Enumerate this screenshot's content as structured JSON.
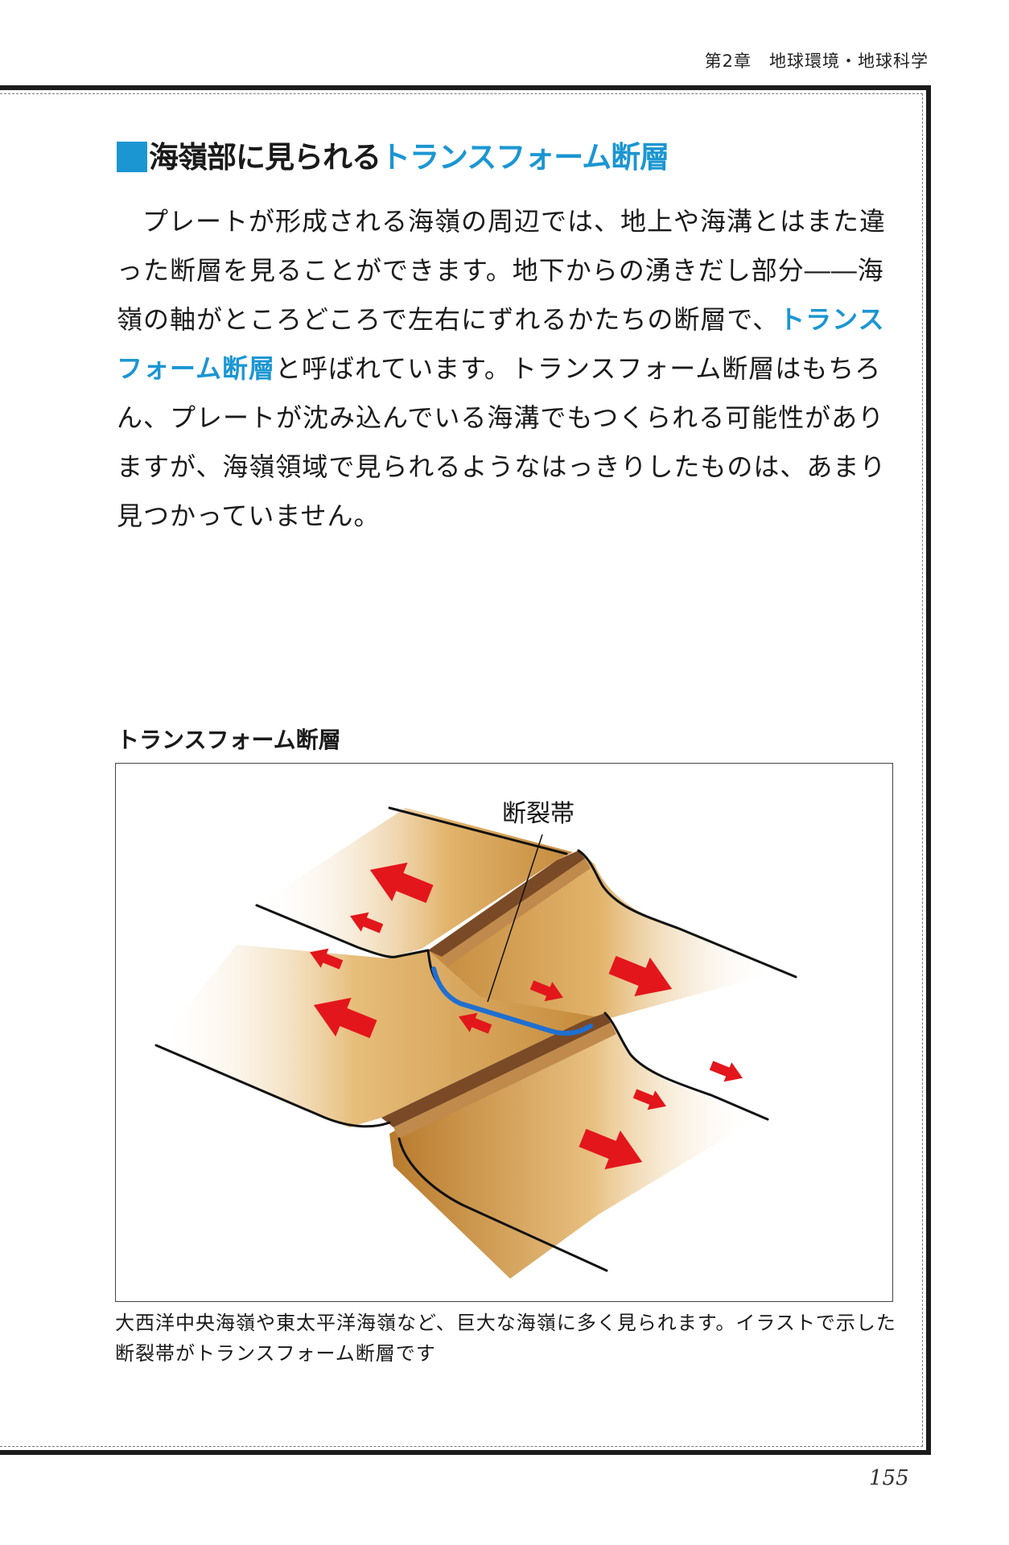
{
  "running_head": "第2章　地球環境・地球科学",
  "section": {
    "title_plain": "海嶺部に見られる",
    "title_accent": "トランスフォーム断層"
  },
  "body": {
    "part1": "プレートが形成される海嶺の周辺では、地上や海溝とはまた違った断層を見ることができます。地下からの湧きだし部分――海嶺の軸がところどころで左右にずれるかたちの断層で、",
    "term": "トランスフォーム断層",
    "part2": "と呼ばれています。トランスフォーム断層はもちろん、プレートが沈み込んでいる海溝でもつくられる可能性がありますが、海嶺領域で見られるようなはっきりしたものは、あまり見つかっていません。"
  },
  "figure": {
    "title": "トランスフォーム断層",
    "label": "断裂帯",
    "caption": "大西洋中央海嶺や東太平洋海嶺など、巨大な海嶺に多く見られます。イラストで示した断裂帯がトランスフォーム断層です"
  },
  "colors": {
    "accent": "#1b96d2",
    "arrow": "#e3161b",
    "plate": "#dca55c",
    "ridge": "#7a4a26",
    "fault": "#1f6fd0"
  },
  "page_number": "155"
}
